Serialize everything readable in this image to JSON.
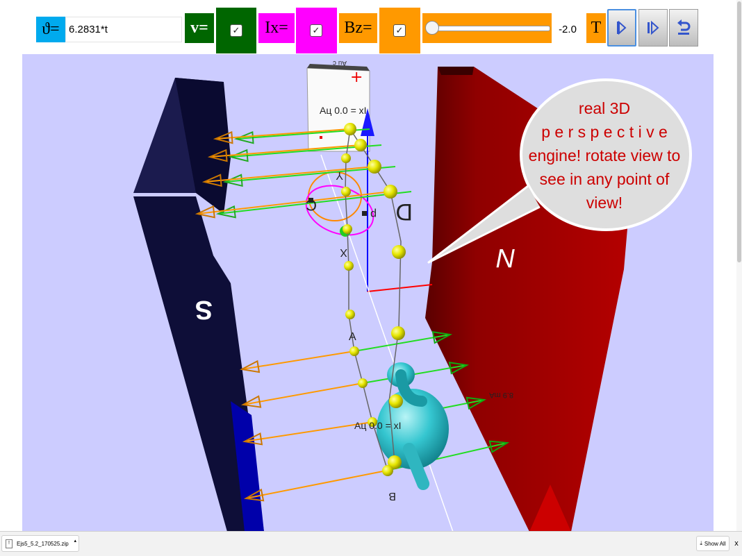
{
  "toolbar": {
    "theta_label": "ϑ=",
    "theta_value": "6.2831*t",
    "v_label": "v=",
    "v_checked": true,
    "ix_label": "Ix=",
    "ix_checked": true,
    "bz_label": "Bz=",
    "bz_checked": true,
    "slider_value": "-2.0",
    "slider_fraction": 0.0,
    "t_label": "T",
    "play_icon": "play-icon",
    "step_icon": "step-forward-icon",
    "reset_icon": "reset-icon"
  },
  "scene": {
    "pole_left_label": "S",
    "pole_right_label": "N",
    "panel_top_label": "Au c",
    "panel_text": "Aц 0.0 = xI",
    "loop_labels": [
      "C",
      "D",
      "p",
      "Y",
      "X",
      "A",
      "B"
    ],
    "bottom_text": "Aц 0.0 = xI",
    "bottom_text_right": "8.9 mA",
    "callout_text": "real   3D perspective engine! rotate view to see in any point of view!",
    "callout_lines": [
      "real   3D",
      "p e r s p e c t i v e",
      "engine! rotate view to",
      "see in any point of",
      "view!"
    ]
  },
  "downloads": {
    "file_name": "Ejs5_5.2_170525.zip",
    "show_all": "Show All",
    "close": "x"
  },
  "colors": {
    "theta_bg": "#00aaee",
    "v_bg": "#006600",
    "ix_bg": "#ff00ff",
    "bz_bg": "#ff9900",
    "scene_bg": "#ccccff",
    "pole_s": "#0a0a40",
    "pole_n": "#a00000",
    "callout_fill": "#dedede",
    "callout_text": "#cc0000"
  }
}
